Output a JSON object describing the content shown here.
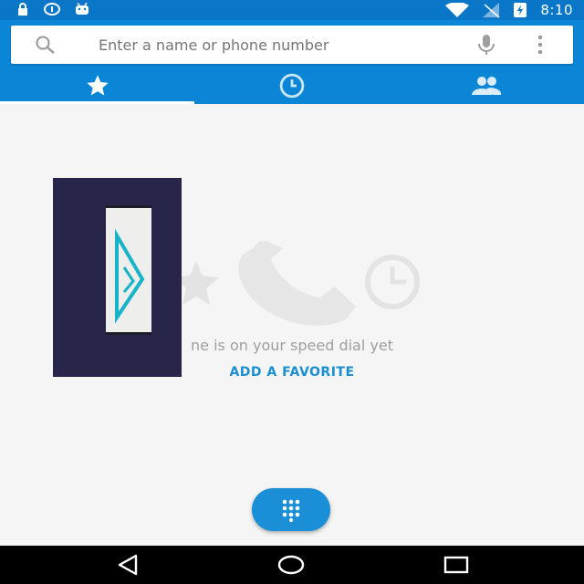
{
  "status_bar": {
    "time": "8:10",
    "icons": [
      "lock-icon",
      "info-icon",
      "android-icon",
      "wifi-icon",
      "no-signal-icon",
      "battery-charging-icon"
    ]
  },
  "search": {
    "placeholder": "Enter a name or phone number",
    "value": ""
  },
  "tabs": [
    {
      "name": "speed-dial",
      "icon": "star-icon",
      "selected": true
    },
    {
      "name": "recents",
      "icon": "clock-icon",
      "selected": false
    },
    {
      "name": "contacts",
      "icon": "people-icon",
      "selected": false
    }
  ],
  "empty_state": {
    "message": "ne is on your speed dial yet",
    "action_label": "ADD A FAVORITE"
  },
  "fab": {
    "icon": "dialpad-icon"
  },
  "nav_bar": {
    "buttons": [
      "back-icon",
      "home-icon",
      "recents-icon"
    ]
  },
  "colors": {
    "status_bar": "#0a76c8",
    "header": "#0b86d6",
    "accent": "#1a8fd0",
    "background": "#f5f5f5",
    "overlay": "#27264a"
  }
}
